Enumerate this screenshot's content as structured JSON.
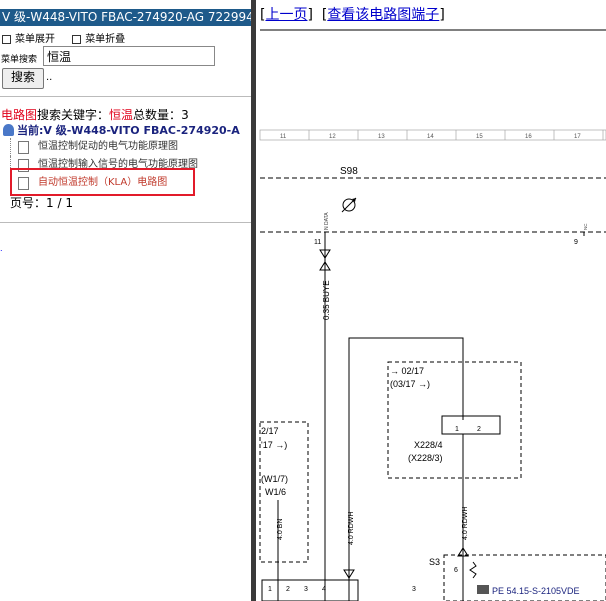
{
  "left": {
    "title": "V 级-W448-VITO FBAC-274920-AG 722994",
    "menu_expand": "菜单展开",
    "menu_collapse": "菜单折叠",
    "search_label": "菜单搜索",
    "search_value": "恒温",
    "search_button": "搜索",
    "dots": "..",
    "result_prefix": "电路图",
    "result_mid": "搜索关键字：",
    "result_keyword": "恒温",
    "result_total_label": "总数量：",
    "result_total": "3",
    "current_label": "当前:V 级-W448-VITO FBAC-274920-A",
    "tree": [
      {
        "label": "恒温控制促动的电气功能原理图"
      },
      {
        "label": "恒温控制输入信号的电气功能原理图"
      },
      {
        "label": "自动恒温控制（KLA）电路图"
      }
    ],
    "page_label": "页号：",
    "page_value": "1 / 1",
    "tiny": "."
  },
  "right": {
    "nav_prev": "上一页",
    "nav_terminals": "查看该电路图端子",
    "ruler": [
      "11",
      "12",
      "13",
      "14",
      "15",
      "16",
      "17"
    ],
    "labels": {
      "s98": "S98",
      "n_data": "N DATA",
      "pin11": "11",
      "pin9": "9",
      "nc": "NC",
      "wire_buye": "0.35 BUYE",
      "ref_0217": "→ 02/17",
      "ref_0317": "(03/17 →)",
      "pin1": "1",
      "pin2": "2",
      "x228_4": "X228/4",
      "x228_3": "(X228/3)",
      "ref2_a": "2/17",
      "ref2_b": "'17 →)",
      "w17": "(W1/7)",
      "w16": "W1/6",
      "wire_bn": "4.0 BN",
      "wire_rdwh1": "4.0 RDWH",
      "wire_rdwh2": "4.0 RDWH",
      "s3": "S3",
      "pin6": "6",
      "conn_nums": [
        "1",
        "2",
        "3",
        "4",
        "3"
      ],
      "pe": "PE 54.15-S-2105VDE"
    }
  }
}
